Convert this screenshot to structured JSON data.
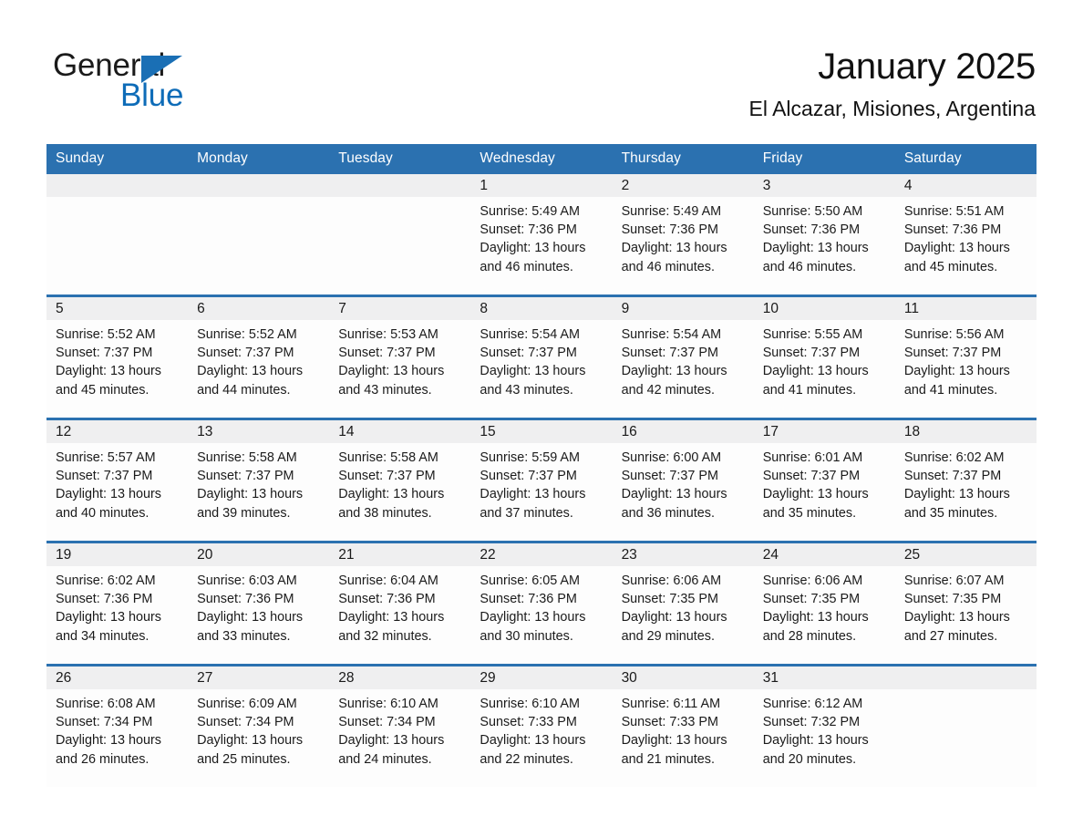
{
  "brand": {
    "name_part1": "General",
    "name_part2": "Blue",
    "flag_icon": "triangle-flag-icon",
    "accent_color": "#0e6cb8"
  },
  "header": {
    "month_title": "January 2025",
    "location": "El Alcazar, Misiones, Argentina"
  },
  "theme": {
    "header_blue": "#2b71b0",
    "daynum_gray": "#efeff0",
    "cell_white": "#fdfdfd",
    "text_dark": "#1b1b1b"
  },
  "calendar": {
    "weekday_headers": [
      "Sunday",
      "Monday",
      "Tuesday",
      "Wednesday",
      "Thursday",
      "Friday",
      "Saturday"
    ],
    "weeks": [
      [
        {
          "day": "",
          "sunrise": "",
          "sunset": "",
          "daylight_line1": "",
          "daylight_line2": "",
          "empty": true
        },
        {
          "day": "",
          "sunrise": "",
          "sunset": "",
          "daylight_line1": "",
          "daylight_line2": "",
          "empty": true
        },
        {
          "day": "",
          "sunrise": "",
          "sunset": "",
          "daylight_line1": "",
          "daylight_line2": "",
          "empty": true
        },
        {
          "day": "1",
          "sunrise": "Sunrise: 5:49 AM",
          "sunset": "Sunset: 7:36 PM",
          "daylight_line1": "Daylight: 13 hours",
          "daylight_line2": "and 46 minutes.",
          "empty": false
        },
        {
          "day": "2",
          "sunrise": "Sunrise: 5:49 AM",
          "sunset": "Sunset: 7:36 PM",
          "daylight_line1": "Daylight: 13 hours",
          "daylight_line2": "and 46 minutes.",
          "empty": false
        },
        {
          "day": "3",
          "sunrise": "Sunrise: 5:50 AM",
          "sunset": "Sunset: 7:36 PM",
          "daylight_line1": "Daylight: 13 hours",
          "daylight_line2": "and 46 minutes.",
          "empty": false
        },
        {
          "day": "4",
          "sunrise": "Sunrise: 5:51 AM",
          "sunset": "Sunset: 7:36 PM",
          "daylight_line1": "Daylight: 13 hours",
          "daylight_line2": "and 45 minutes.",
          "empty": false
        }
      ],
      [
        {
          "day": "5",
          "sunrise": "Sunrise: 5:52 AM",
          "sunset": "Sunset: 7:37 PM",
          "daylight_line1": "Daylight: 13 hours",
          "daylight_line2": "and 45 minutes.",
          "empty": false
        },
        {
          "day": "6",
          "sunrise": "Sunrise: 5:52 AM",
          "sunset": "Sunset: 7:37 PM",
          "daylight_line1": "Daylight: 13 hours",
          "daylight_line2": "and 44 minutes.",
          "empty": false
        },
        {
          "day": "7",
          "sunrise": "Sunrise: 5:53 AM",
          "sunset": "Sunset: 7:37 PM",
          "daylight_line1": "Daylight: 13 hours",
          "daylight_line2": "and 43 minutes.",
          "empty": false
        },
        {
          "day": "8",
          "sunrise": "Sunrise: 5:54 AM",
          "sunset": "Sunset: 7:37 PM",
          "daylight_line1": "Daylight: 13 hours",
          "daylight_line2": "and 43 minutes.",
          "empty": false
        },
        {
          "day": "9",
          "sunrise": "Sunrise: 5:54 AM",
          "sunset": "Sunset: 7:37 PM",
          "daylight_line1": "Daylight: 13 hours",
          "daylight_line2": "and 42 minutes.",
          "empty": false
        },
        {
          "day": "10",
          "sunrise": "Sunrise: 5:55 AM",
          "sunset": "Sunset: 7:37 PM",
          "daylight_line1": "Daylight: 13 hours",
          "daylight_line2": "and 41 minutes.",
          "empty": false
        },
        {
          "day": "11",
          "sunrise": "Sunrise: 5:56 AM",
          "sunset": "Sunset: 7:37 PM",
          "daylight_line1": "Daylight: 13 hours",
          "daylight_line2": "and 41 minutes.",
          "empty": false
        }
      ],
      [
        {
          "day": "12",
          "sunrise": "Sunrise: 5:57 AM",
          "sunset": "Sunset: 7:37 PM",
          "daylight_line1": "Daylight: 13 hours",
          "daylight_line2": "and 40 minutes.",
          "empty": false
        },
        {
          "day": "13",
          "sunrise": "Sunrise: 5:58 AM",
          "sunset": "Sunset: 7:37 PM",
          "daylight_line1": "Daylight: 13 hours",
          "daylight_line2": "and 39 minutes.",
          "empty": false
        },
        {
          "day": "14",
          "sunrise": "Sunrise: 5:58 AM",
          "sunset": "Sunset: 7:37 PM",
          "daylight_line1": "Daylight: 13 hours",
          "daylight_line2": "and 38 minutes.",
          "empty": false
        },
        {
          "day": "15",
          "sunrise": "Sunrise: 5:59 AM",
          "sunset": "Sunset: 7:37 PM",
          "daylight_line1": "Daylight: 13 hours",
          "daylight_line2": "and 37 minutes.",
          "empty": false
        },
        {
          "day": "16",
          "sunrise": "Sunrise: 6:00 AM",
          "sunset": "Sunset: 7:37 PM",
          "daylight_line1": "Daylight: 13 hours",
          "daylight_line2": "and 36 minutes.",
          "empty": false
        },
        {
          "day": "17",
          "sunrise": "Sunrise: 6:01 AM",
          "sunset": "Sunset: 7:37 PM",
          "daylight_line1": "Daylight: 13 hours",
          "daylight_line2": "and 35 minutes.",
          "empty": false
        },
        {
          "day": "18",
          "sunrise": "Sunrise: 6:02 AM",
          "sunset": "Sunset: 7:37 PM",
          "daylight_line1": "Daylight: 13 hours",
          "daylight_line2": "and 35 minutes.",
          "empty": false
        }
      ],
      [
        {
          "day": "19",
          "sunrise": "Sunrise: 6:02 AM",
          "sunset": "Sunset: 7:36 PM",
          "daylight_line1": "Daylight: 13 hours",
          "daylight_line2": "and 34 minutes.",
          "empty": false
        },
        {
          "day": "20",
          "sunrise": "Sunrise: 6:03 AM",
          "sunset": "Sunset: 7:36 PM",
          "daylight_line1": "Daylight: 13 hours",
          "daylight_line2": "and 33 minutes.",
          "empty": false
        },
        {
          "day": "21",
          "sunrise": "Sunrise: 6:04 AM",
          "sunset": "Sunset: 7:36 PM",
          "daylight_line1": "Daylight: 13 hours",
          "daylight_line2": "and 32 minutes.",
          "empty": false
        },
        {
          "day": "22",
          "sunrise": "Sunrise: 6:05 AM",
          "sunset": "Sunset: 7:36 PM",
          "daylight_line1": "Daylight: 13 hours",
          "daylight_line2": "and 30 minutes.",
          "empty": false
        },
        {
          "day": "23",
          "sunrise": "Sunrise: 6:06 AM",
          "sunset": "Sunset: 7:35 PM",
          "daylight_line1": "Daylight: 13 hours",
          "daylight_line2": "and 29 minutes.",
          "empty": false
        },
        {
          "day": "24",
          "sunrise": "Sunrise: 6:06 AM",
          "sunset": "Sunset: 7:35 PM",
          "daylight_line1": "Daylight: 13 hours",
          "daylight_line2": "and 28 minutes.",
          "empty": false
        },
        {
          "day": "25",
          "sunrise": "Sunrise: 6:07 AM",
          "sunset": "Sunset: 7:35 PM",
          "daylight_line1": "Daylight: 13 hours",
          "daylight_line2": "and 27 minutes.",
          "empty": false
        }
      ],
      [
        {
          "day": "26",
          "sunrise": "Sunrise: 6:08 AM",
          "sunset": "Sunset: 7:34 PM",
          "daylight_line1": "Daylight: 13 hours",
          "daylight_line2": "and 26 minutes.",
          "empty": false
        },
        {
          "day": "27",
          "sunrise": "Sunrise: 6:09 AM",
          "sunset": "Sunset: 7:34 PM",
          "daylight_line1": "Daylight: 13 hours",
          "daylight_line2": "and 25 minutes.",
          "empty": false
        },
        {
          "day": "28",
          "sunrise": "Sunrise: 6:10 AM",
          "sunset": "Sunset: 7:34 PM",
          "daylight_line1": "Daylight: 13 hours",
          "daylight_line2": "and 24 minutes.",
          "empty": false
        },
        {
          "day": "29",
          "sunrise": "Sunrise: 6:10 AM",
          "sunset": "Sunset: 7:33 PM",
          "daylight_line1": "Daylight: 13 hours",
          "daylight_line2": "and 22 minutes.",
          "empty": false
        },
        {
          "day": "30",
          "sunrise": "Sunrise: 6:11 AM",
          "sunset": "Sunset: 7:33 PM",
          "daylight_line1": "Daylight: 13 hours",
          "daylight_line2": "and 21 minutes.",
          "empty": false
        },
        {
          "day": "31",
          "sunrise": "Sunrise: 6:12 AM",
          "sunset": "Sunset: 7:32 PM",
          "daylight_line1": "Daylight: 13 hours",
          "daylight_line2": "and 20 minutes.",
          "empty": false
        },
        {
          "day": "",
          "sunrise": "",
          "sunset": "",
          "daylight_line1": "",
          "daylight_line2": "",
          "empty": true
        }
      ]
    ]
  }
}
